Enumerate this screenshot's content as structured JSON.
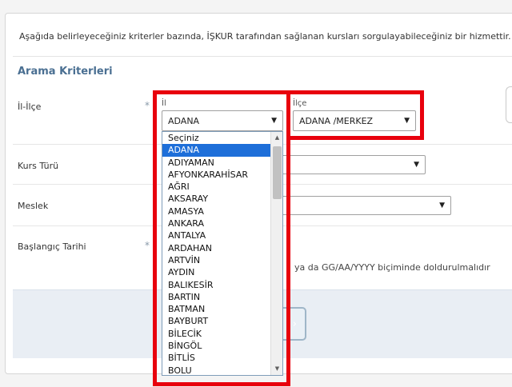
{
  "intro_text": "Aşağıda belirleyeceğiniz kriterler bazında, İŞKUR tarafından sağlanan kursları sorgulayabileceğiniz bir hizmettir.",
  "section_title": "Arama Kriterleri",
  "required_mark": "*",
  "fields": {
    "il_ilce_label": "İl-İlçe",
    "kurs_turu_label": "Kurs Türü",
    "meslek_label": "Meslek",
    "baslangic_label": "Başlangıç Tarihi"
  },
  "il": {
    "label": "İl",
    "value": "ADANA",
    "options": [
      "Seçiniz",
      "ADANA",
      "ADIYAMAN",
      "AFYONKARAHİSAR",
      "AĞRI",
      "AKSARAY",
      "AMASYA",
      "ANKARA",
      "ANTALYA",
      "ARDAHAN",
      "ARTVİN",
      "AYDIN",
      "BALIKESİR",
      "BARTIN",
      "BATMAN",
      "BAYBURT",
      "BİLECİK",
      "BİNGÖL",
      "BİTLİS",
      "BOLU"
    ],
    "selected_index": 1
  },
  "ilce": {
    "label": "İlçe",
    "value": "ADANA /MERKEZ"
  },
  "date_hint": "ya da GG/AA/YYYY biçiminde doldurulmalıdır",
  "icons": {
    "dropdown": "triangle-down",
    "scroll_up": "triangle-up",
    "scroll_down": "triangle-down",
    "button": "chevron-right"
  },
  "colors": {
    "highlight_frame": "#e8000d",
    "selected_option": "#1e6fd9",
    "section_title": "#4a6f92"
  }
}
